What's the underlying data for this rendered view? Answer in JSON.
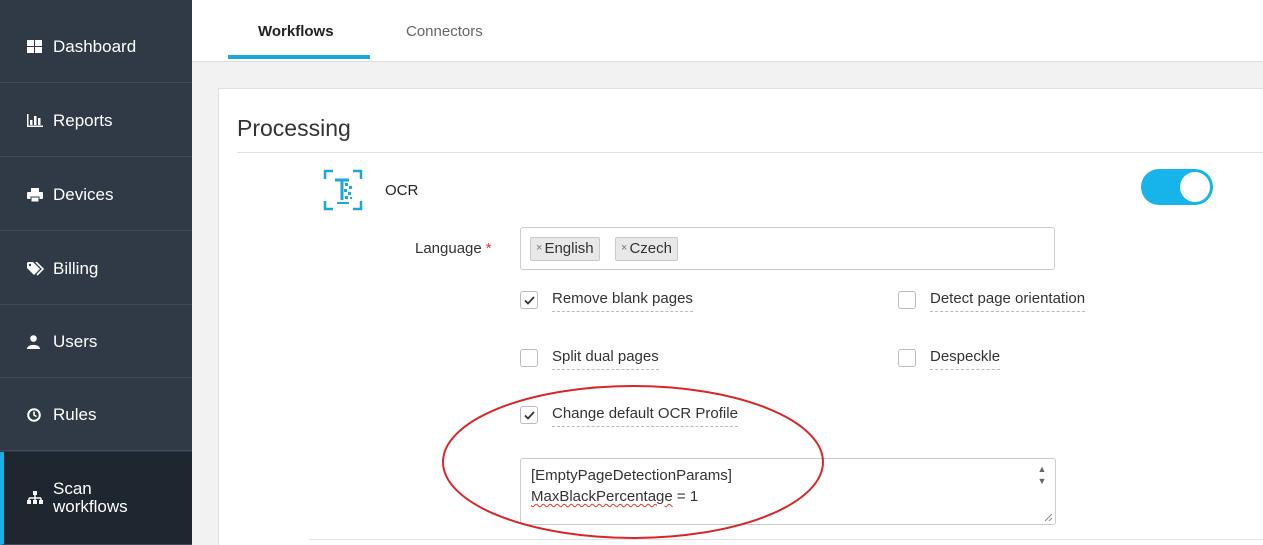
{
  "sidebar": {
    "items": [
      {
        "label": "Dashboard",
        "icon": "grid-icon"
      },
      {
        "label": "Reports",
        "icon": "bar-chart-icon"
      },
      {
        "label": "Devices",
        "icon": "printer-icon"
      },
      {
        "label": "Billing",
        "icon": "tags-icon"
      },
      {
        "label": "Users",
        "icon": "user-icon"
      },
      {
        "label": "Rules",
        "icon": "clock-icon"
      },
      {
        "label_line1": "Scan",
        "label_line2": "workflows",
        "icon": "sitemap-icon",
        "active": true
      }
    ]
  },
  "tabs": [
    {
      "label": "Workflows",
      "active": true
    },
    {
      "label": "Connectors",
      "active": false
    }
  ],
  "panel": {
    "title": "Processing",
    "ocr": {
      "label": "OCR",
      "enabled": true
    },
    "language": {
      "label": "Language",
      "required_mark": "*",
      "tags": [
        "English",
        "Czech"
      ],
      "remove_glyph": "×"
    },
    "options": {
      "remove_blank_pages": {
        "label": "Remove blank pages",
        "checked": true
      },
      "detect_page_orientation": {
        "label": "Detect page orientation",
        "checked": false
      },
      "split_dual_pages": {
        "label": "Split dual pages",
        "checked": false
      },
      "despeckle": {
        "label": "Despeckle",
        "checked": false
      },
      "change_default_ocr_profile": {
        "label": "Change default OCR Profile",
        "checked": true
      }
    },
    "profile_text": {
      "line1": "[EmptyPageDetectionParams]",
      "line2_word": "MaxBlackPercentage",
      "line2_rest": " = 1"
    }
  },
  "colors": {
    "accent": "#16b4ea",
    "sidebar_bg": "#2f3a46",
    "annotation": "#d62828"
  }
}
